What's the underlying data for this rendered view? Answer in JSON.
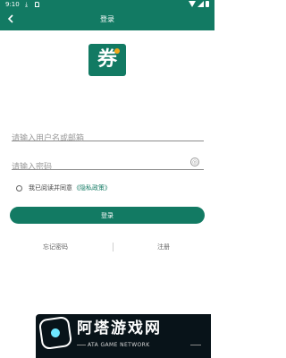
{
  "status_bar": {
    "time": "9:10"
  },
  "header": {
    "title": "登录"
  },
  "logo": {
    "text": "券"
  },
  "username": {
    "placeholder": "请输入用户名或邮箱",
    "value": ""
  },
  "password": {
    "placeholder": "请输入密码",
    "value": ""
  },
  "agreement": {
    "text": "我已阅读并同意",
    "link": "《隐私政策》"
  },
  "login_button": {
    "label": "登录"
  },
  "links": {
    "forgot": "忘记密码",
    "register": "注册"
  },
  "watermark": {
    "cn": "阿塔游戏网",
    "en": "ATA GAME NETWORK"
  },
  "colors": {
    "primary": "#127a63",
    "seed": "#f2a81b",
    "watermark_bg": "#081319"
  },
  "icons": [
    "download-icon",
    "sd-card-icon",
    "wifi-icon",
    "signal-icon",
    "battery-icon",
    "back-arrow-icon",
    "eye-icon",
    "radio-icon",
    "game-controller-icon"
  ]
}
